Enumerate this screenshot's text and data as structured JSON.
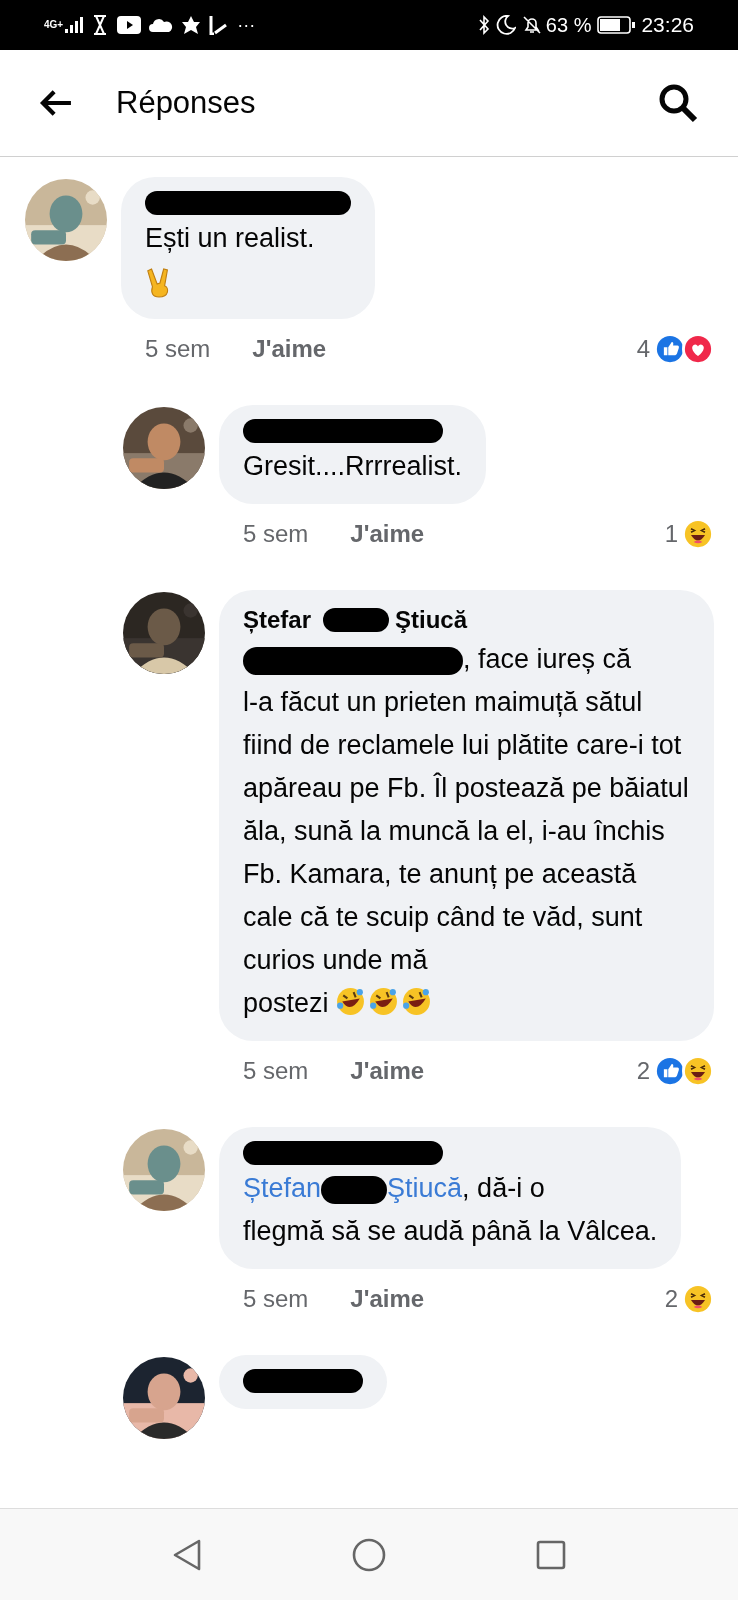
{
  "status_bar": {
    "network": "4G+",
    "more": "···",
    "battery": "63 %",
    "time": "23:26"
  },
  "header": {
    "title": "Réponses"
  },
  "comments": [
    {
      "author": [
        {
          "kind": "redacted"
        }
      ],
      "body": [
        {
          "kind": "text",
          "text": "Ești un realist."
        },
        {
          "kind": "break"
        },
        {
          "kind": "victory"
        }
      ],
      "time": "5 sem",
      "like": "J'aime",
      "reaction_count": "4",
      "reactions": [
        {
          "kind": "like"
        },
        {
          "kind": "love"
        }
      ],
      "children": [
        {
          "author": [
            {
              "kind": "redacted"
            }
          ],
          "body": [
            {
              "kind": "text",
              "text": "Gresit....Rrrrealist."
            }
          ],
          "time": "5 sem",
          "like": "J'aime",
          "reaction_count": "1",
          "reactions": [
            {
              "kind": "haha"
            }
          ]
        },
        {
          "author": [
            {
              "kind": "text",
              "text": "Ștefar"
            },
            {
              "kind": "redacted"
            },
            {
              "kind": "text",
              "text": "Ştiucă"
            }
          ],
          "body": [
            {
              "kind": "redacted"
            },
            {
              "kind": "text",
              "text": ", face iureș că"
            },
            {
              "kind": "break"
            },
            {
              "kind": "text",
              "text": "l-a făcut un prieten maimuță sătul fiind de reclamele lui plătite care-i tot apăreau pe Fb. Îl postează pe băiatul ăla, sună la muncă la el, i-au închis Fb. Kamara, te anunț pe această cale că te scuip când te văd, sunt curios unde mă"
            },
            {
              "kind": "break"
            },
            {
              "kind": "text",
              "text": "postezi"
            },
            {
              "kind": "rofl"
            },
            {
              "kind": "rofl"
            },
            {
              "kind": "rofl"
            }
          ],
          "time": "5 sem",
          "like": "J'aime",
          "reaction_count": "2",
          "reactions": [
            {
              "kind": "like"
            },
            {
              "kind": "haha"
            }
          ]
        },
        {
          "author": [
            {
              "kind": "redacted"
            }
          ],
          "body": [
            {
              "kind": "mention",
              "text": "Ștefan"
            },
            {
              "kind": "redacted"
            },
            {
              "kind": "mention",
              "text": "Ştiucă"
            },
            {
              "kind": "text",
              "text": ", dă-i o"
            },
            {
              "kind": "break"
            },
            {
              "kind": "text",
              "text": "flegmă să se audă până la Vâlcea."
            }
          ],
          "time": "5 sem",
          "like": "J'aime",
          "reaction_count": "2",
          "reactions": [
            {
              "kind": "haha"
            }
          ]
        },
        {
          "author": [
            {
              "kind": "redacted"
            }
          ]
        }
      ]
    }
  ]
}
